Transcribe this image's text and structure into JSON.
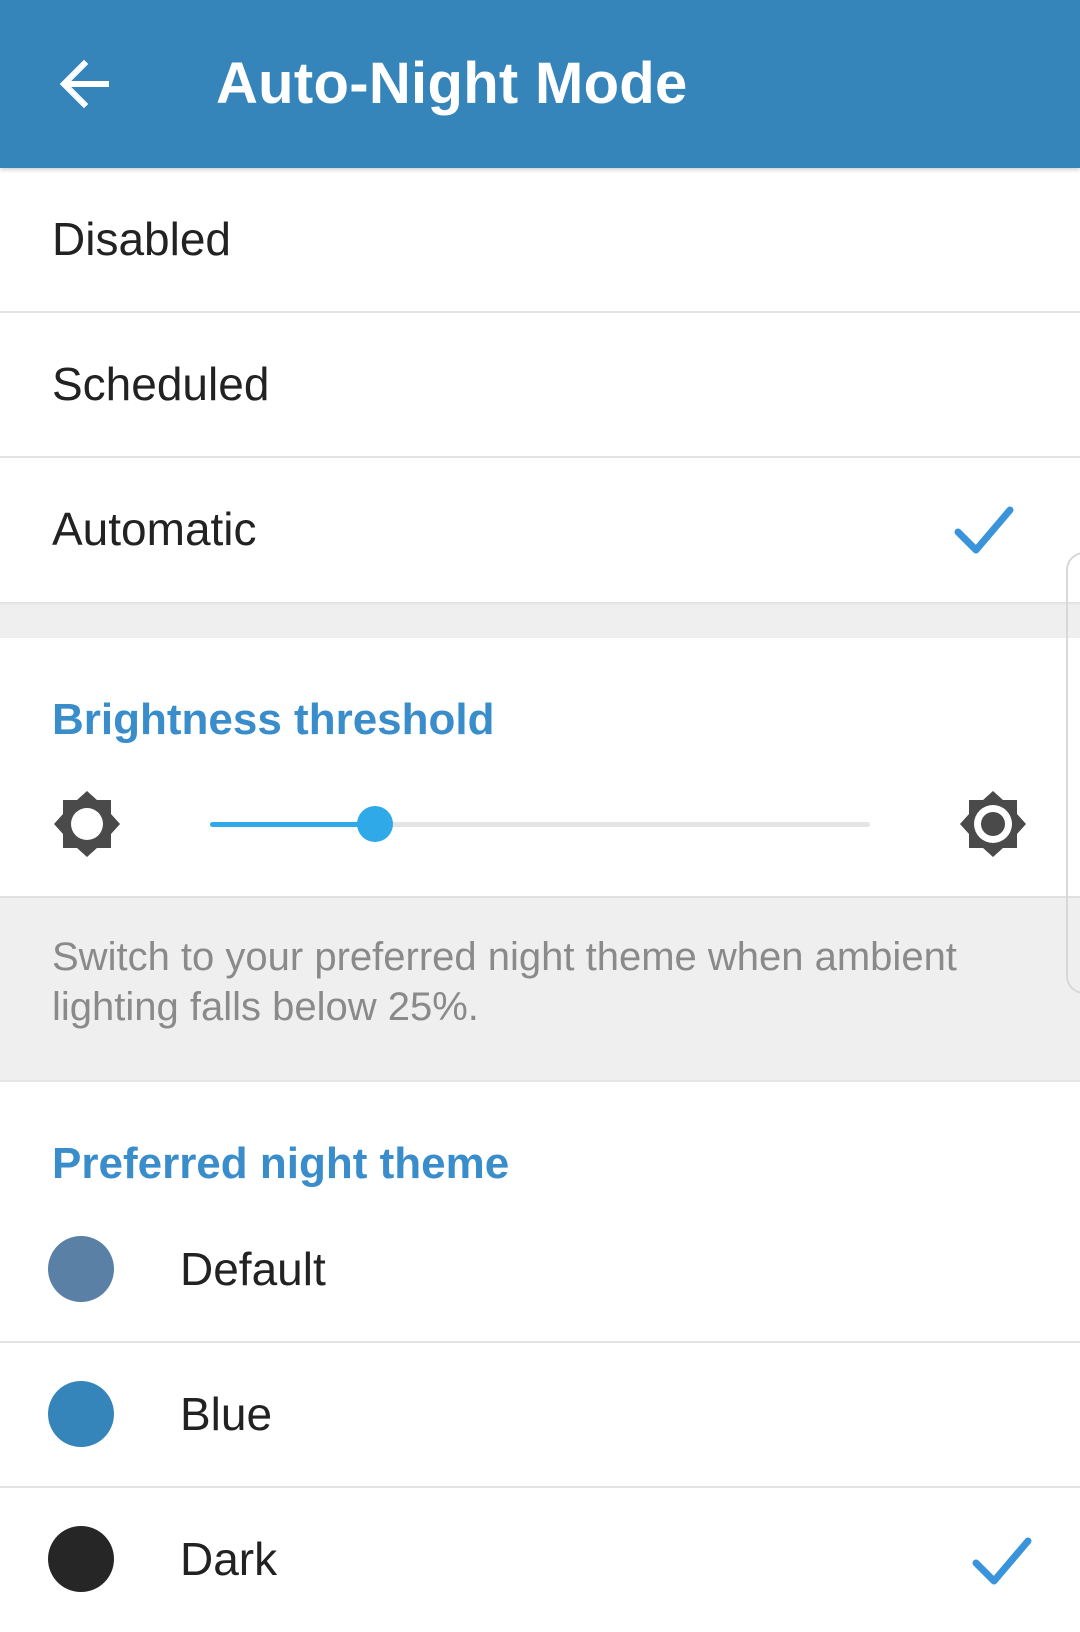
{
  "header": {
    "title": "Auto-Night Mode",
    "back_icon": "arrow-left-icon",
    "background_color": "#3585bb"
  },
  "modes": {
    "items": [
      {
        "label": "Disabled",
        "selected": false
      },
      {
        "label": "Scheduled",
        "selected": false
      },
      {
        "label": "Automatic",
        "selected": true
      }
    ],
    "check_icon": "checkmark-icon",
    "check_color": "#3a94dc"
  },
  "brightness": {
    "header": "Brightness threshold",
    "min_icon": "brightness-low-icon",
    "max_icon": "brightness-high-icon",
    "value_fraction": 0.25,
    "accent_color": "#2fa9e8",
    "description": "Switch to your preferred night theme when ambient lighting falls below 25%."
  },
  "night_theme": {
    "header": "Preferred night theme",
    "items": [
      {
        "label": "Default",
        "color": "#5a80a6",
        "selected": false
      },
      {
        "label": "Blue",
        "color": "#3585bb",
        "selected": false
      },
      {
        "label": "Dark",
        "color": "#262626",
        "selected": true
      }
    ]
  },
  "section_header_color": "#3a8dcb"
}
